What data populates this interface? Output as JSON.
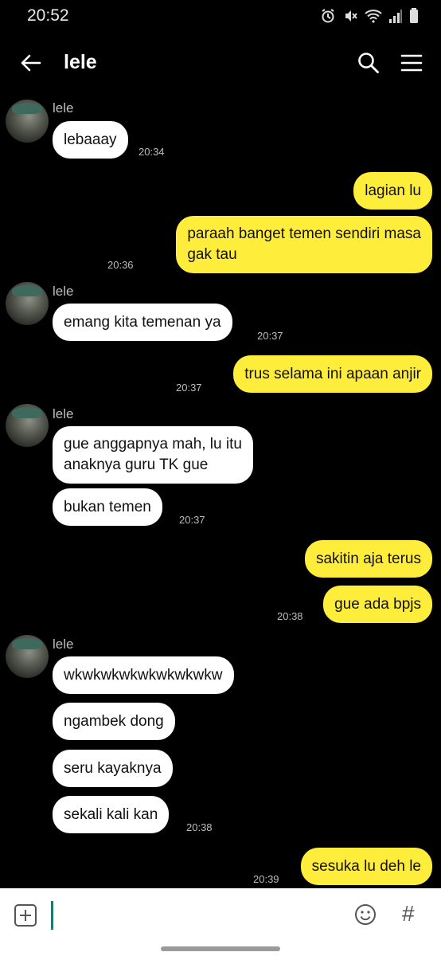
{
  "status_bar": {
    "time": "20:52"
  },
  "header": {
    "title": "lele"
  },
  "messages": {
    "sender_name": "lele",
    "m1": {
      "text": "lebaaay",
      "time": "20:34"
    },
    "m2": {
      "text": "lagian lu"
    },
    "m3": {
      "line1": "paraah banget temen sendiri masa",
      "line2": "gak tau",
      "time": "20:36"
    },
    "m4": {
      "text": "emang kita temenan ya",
      "time": "20:37"
    },
    "m5": {
      "text": "trus selama ini apaan anjir",
      "time": "20:37"
    },
    "m6": {
      "line1": "gue anggapnya mah, lu itu",
      "line2": "anaknya guru TK gue"
    },
    "m7": {
      "text": "bukan temen",
      "time": "20:37"
    },
    "m8": {
      "text": "sakitin aja terus"
    },
    "m9": {
      "text": "gue ada bpjs",
      "time": "20:38"
    },
    "m10": {
      "text": "wkwkwkwkwkwkwkwkw"
    },
    "m11": {
      "text": "ngambek dong"
    },
    "m12": {
      "text": "seru kayaknya"
    },
    "m13": {
      "text": "sekali kali kan",
      "time": "20:38"
    },
    "m14": {
      "text": "sesuka lu deh le",
      "time": "20:39"
    }
  },
  "input_bar": {
    "text": "",
    "accent_color": "#1f7b67"
  },
  "colors": {
    "incoming_bubble": "#ffffff",
    "outgoing_bubble": "#ffed3b",
    "background": "#000000"
  },
  "icons": [
    "back-arrow-icon",
    "search-icon",
    "menu-icon",
    "plus-icon",
    "emoji-icon",
    "hashtag-icon"
  ]
}
